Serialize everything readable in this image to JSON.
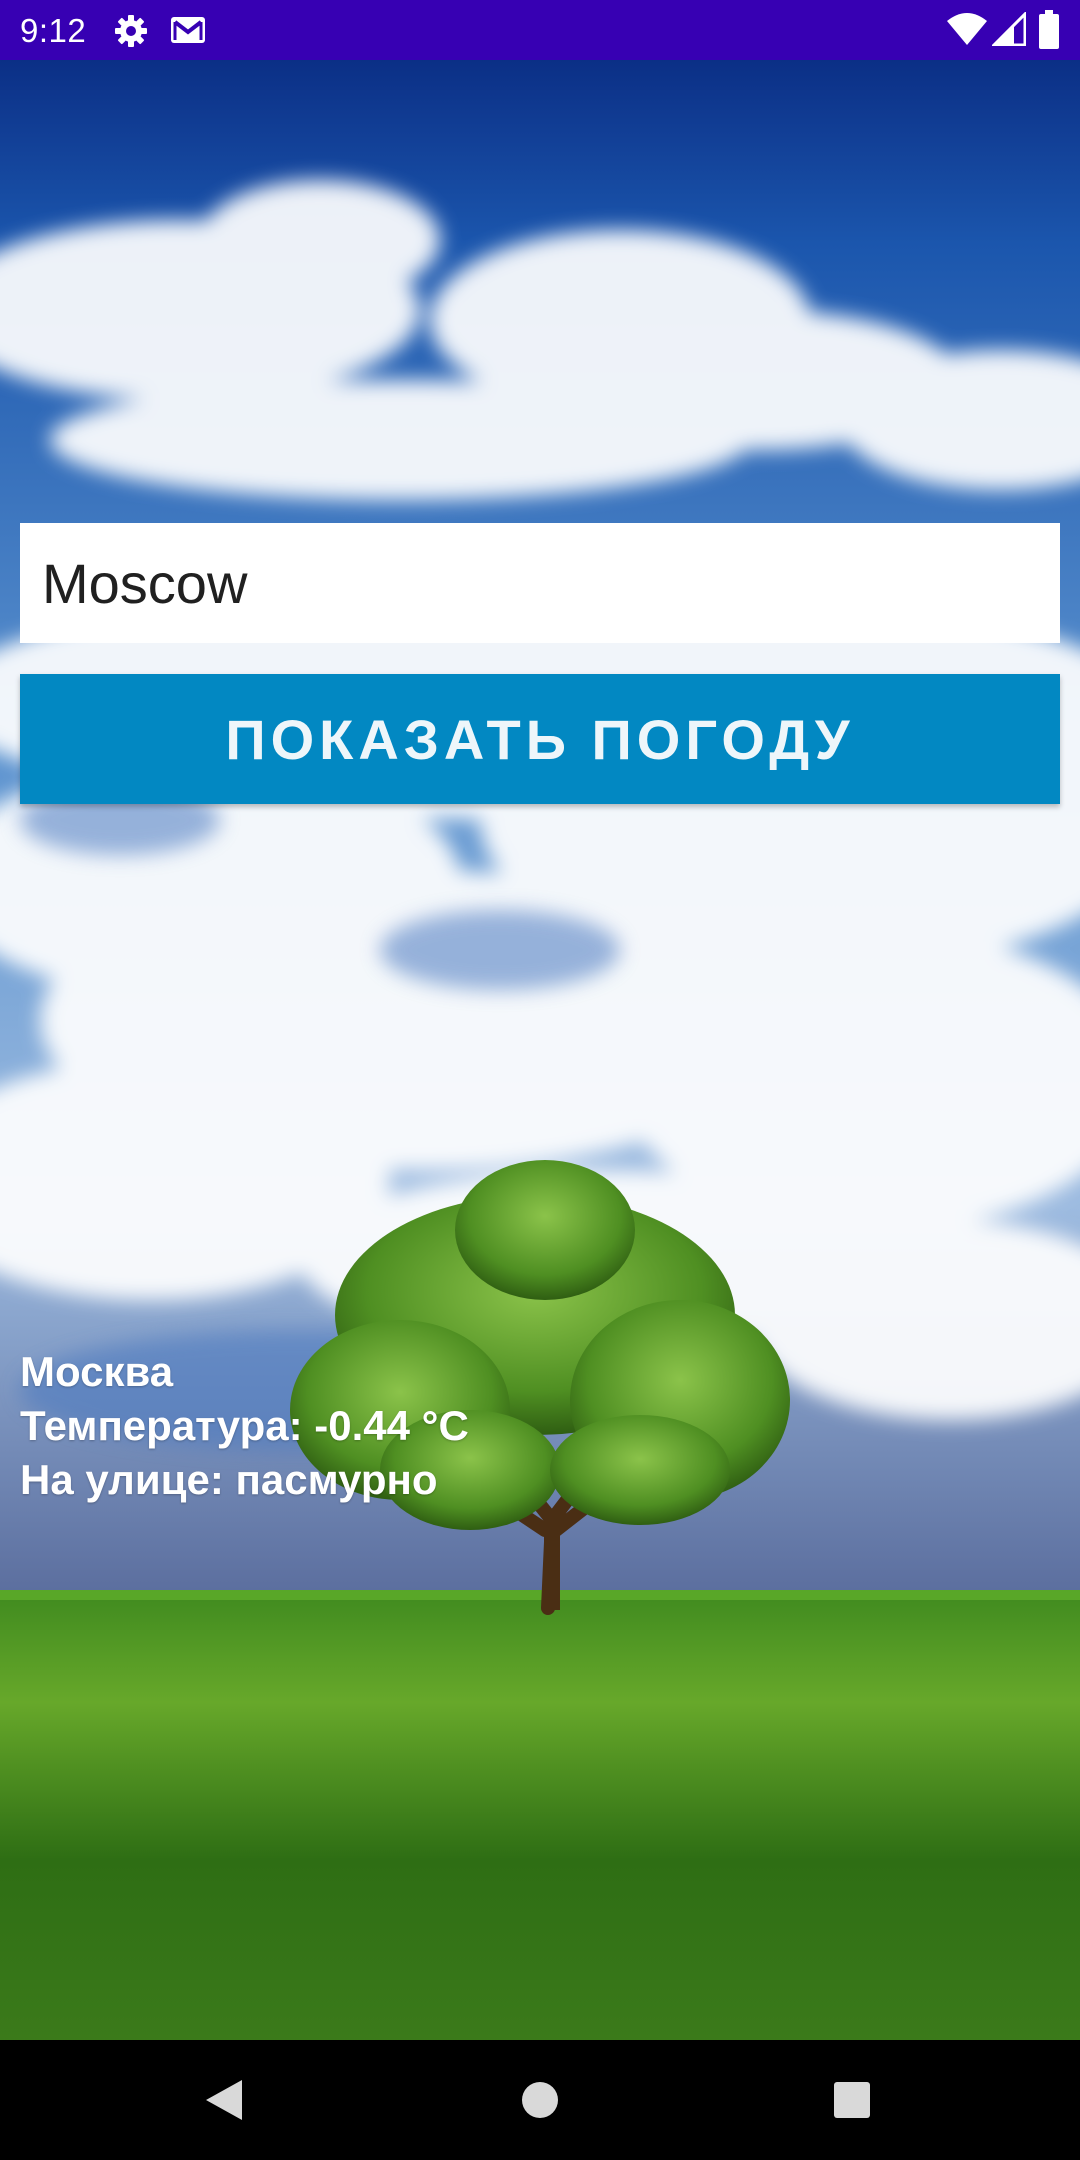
{
  "status_bar": {
    "time": "9:12",
    "left_icons": [
      "gear-icon",
      "gmail-icon"
    ],
    "right_icons": [
      "wifi-icon",
      "signal-icon",
      "battery-icon"
    ],
    "color": "#3700b3"
  },
  "search": {
    "city_value": "Moscow"
  },
  "button": {
    "label": "ПОКАЗАТЬ ПОГОДУ",
    "color": "#0288c2"
  },
  "weather": {
    "city": "Москва",
    "temperature": "Температура: -0.44 °C",
    "condition": "На улице: пасмурно"
  },
  "nav_bar": {
    "buttons": [
      "back-icon",
      "home-icon",
      "recents-icon"
    ]
  }
}
